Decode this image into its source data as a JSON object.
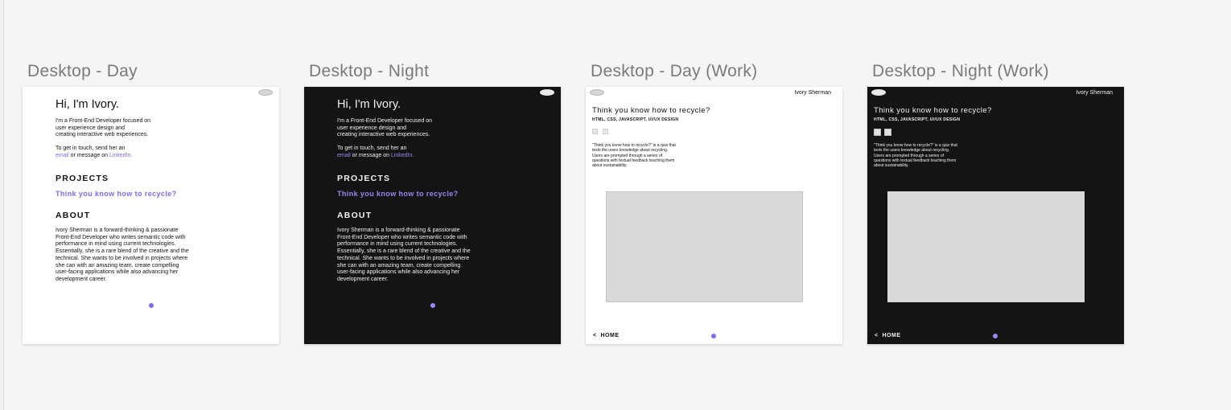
{
  "frames": [
    {
      "title": "Desktop - Day"
    },
    {
      "title": "Desktop -  Night"
    },
    {
      "title": "Desktop - Day (Work)"
    },
    {
      "title": "Desktop - Night (Work)"
    }
  ],
  "home": {
    "greeting": "Hi, I'm Ivory.",
    "intro": "I'm a Front-End Developer focused on\nuser experience design and\ncreating interactive web experiences.",
    "contact_prefix": "To get in touch, send her an",
    "contact_email": "email",
    "contact_middle": " or message on ",
    "contact_linkedin": "LinkedIn.",
    "projects_heading": "PROJECTS",
    "project_link": "Think you know how to recycle?",
    "about_heading": "ABOUT",
    "about_text": "Ivory Sherman is a forward-thinking & passionate\nFront-End Developer who writes semantic code with\nperformance in mind using current technologies.\nEssentially, she is a rare blend of the creative and the\ntechnical. She wants to be involved in projects where\nshe can with an amazing team, create compelling\nuser-facing applications while also advancing her\ndevelopment career."
  },
  "work": {
    "name": "Ivory Sherman",
    "title": "Think you know how to recycle?",
    "tags": "HTML, CSS, JAVASCRIPT, UI/UX DESIGN",
    "description": "\"Think you know how to recycle?\" is a quiz that\ntests the users knowledge about recycling.\nUsers are prompted through a series of\nquestions with textual feedback teaching them\nabout sustainability.",
    "back_arrow": "<",
    "back_label": "HOME"
  },
  "colors": {
    "accent": "#7b6cf0",
    "night_bg": "#141414",
    "day_bg": "#ffffff",
    "preview_placeholder": "#d9d9d9"
  }
}
